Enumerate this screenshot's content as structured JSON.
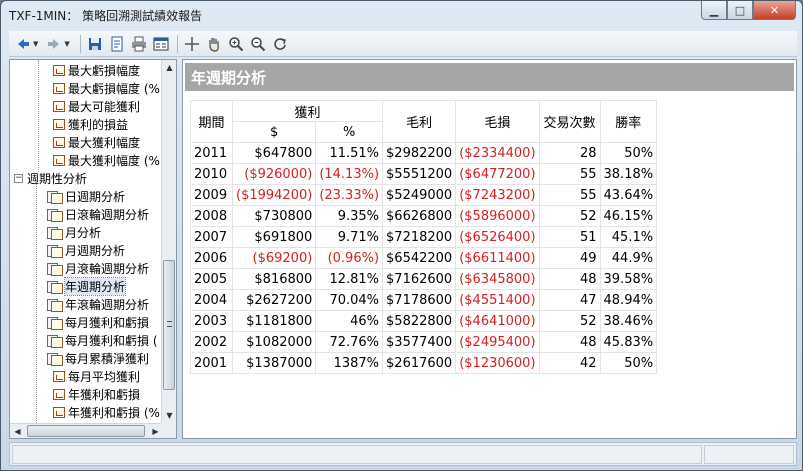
{
  "window": {
    "title": "TXF-1MIN： 策略回溯測試績效報告"
  },
  "toolbar": {
    "buttons": [
      "back-icon",
      "forward-icon",
      "save-icon",
      "page-setup-icon",
      "print-icon",
      "view-icon",
      "crosshair-icon",
      "hand-icon",
      "zoom-in-icon",
      "zoom-out-icon",
      "refresh-icon"
    ]
  },
  "tree": {
    "items": [
      {
        "label": "最大虧損幅度",
        "kind": "report"
      },
      {
        "label": "最大虧損幅度 (%",
        "kind": "report"
      },
      {
        "label": "最大可能獲利",
        "kind": "report"
      },
      {
        "label": "獲利的損益",
        "kind": "report"
      },
      {
        "label": "最大獲利幅度",
        "kind": "report"
      },
      {
        "label": "最大獲利幅度 (%",
        "kind": "report"
      },
      {
        "label": "週期性分析",
        "kind": "folder"
      },
      {
        "label": "日週期分析",
        "kind": "sub"
      },
      {
        "label": "日滾輪週期分析",
        "kind": "sub"
      },
      {
        "label": "月分析",
        "kind": "sub"
      },
      {
        "label": "月週期分析",
        "kind": "sub"
      },
      {
        "label": "月滾輪週期分析",
        "kind": "sub"
      },
      {
        "label": "年週期分析",
        "kind": "sub",
        "selected": true
      },
      {
        "label": "年滾輪週期分析",
        "kind": "sub"
      },
      {
        "label": "每月獲利和虧損",
        "kind": "sub"
      },
      {
        "label": "每月獲利和虧損 (",
        "kind": "sub"
      },
      {
        "label": "每月累積淨獲利",
        "kind": "sub"
      },
      {
        "label": "每月平均獲利",
        "kind": "report"
      },
      {
        "label": "年獲利和虧損",
        "kind": "report"
      },
      {
        "label": "年獲利和虧損 (%",
        "kind": "report"
      }
    ]
  },
  "report": {
    "title": "年週期分析",
    "headers": {
      "period": "期間",
      "profit": "獲利",
      "profit_dollar": "$",
      "profit_pct": "%",
      "gross_profit": "毛利",
      "gross_loss": "毛損",
      "trades": "交易次數",
      "win_rate": "勝率"
    },
    "rows": [
      {
        "year": "2011",
        "profit": "$647800",
        "pct": "11.51%",
        "gross_profit": "$2982200",
        "gross_loss": "($2334400)",
        "trades": "28",
        "win_rate": "50%",
        "negative": false
      },
      {
        "year": "2010",
        "profit": "($926000)",
        "pct": "(14.13%)",
        "gross_profit": "$5551200",
        "gross_loss": "($6477200)",
        "trades": "55",
        "win_rate": "38.18%",
        "negative": true
      },
      {
        "year": "2009",
        "profit": "($1994200)",
        "pct": "(23.33%)",
        "gross_profit": "$5249000",
        "gross_loss": "($7243200)",
        "trades": "55",
        "win_rate": "43.64%",
        "negative": true
      },
      {
        "year": "2008",
        "profit": "$730800",
        "pct": "9.35%",
        "gross_profit": "$6626800",
        "gross_loss": "($5896000)",
        "trades": "52",
        "win_rate": "46.15%",
        "negative": false
      },
      {
        "year": "2007",
        "profit": "$691800",
        "pct": "9.71%",
        "gross_profit": "$7218200",
        "gross_loss": "($6526400)",
        "trades": "51",
        "win_rate": "45.1%",
        "negative": false
      },
      {
        "year": "2006",
        "profit": "($69200)",
        "pct": "(0.96%)",
        "gross_profit": "$6542200",
        "gross_loss": "($6611400)",
        "trades": "49",
        "win_rate": "44.9%",
        "negative": true
      },
      {
        "year": "2005",
        "profit": "$816800",
        "pct": "12.81%",
        "gross_profit": "$7162600",
        "gross_loss": "($6345800)",
        "trades": "48",
        "win_rate": "39.58%",
        "negative": false
      },
      {
        "year": "2004",
        "profit": "$2627200",
        "pct": "70.04%",
        "gross_profit": "$7178600",
        "gross_loss": "($4551400)",
        "trades": "47",
        "win_rate": "48.94%",
        "negative": false
      },
      {
        "year": "2003",
        "profit": "$1181800",
        "pct": "46%",
        "gross_profit": "$5822800",
        "gross_loss": "($4641000)",
        "trades": "52",
        "win_rate": "38.46%",
        "negative": false
      },
      {
        "year": "2002",
        "profit": "$1082000",
        "pct": "72.76%",
        "gross_profit": "$3577400",
        "gross_loss": "($2495400)",
        "trades": "48",
        "win_rate": "45.83%",
        "negative": false
      },
      {
        "year": "2001",
        "profit": "$1387000",
        "pct": "1387%",
        "gross_profit": "$2617600",
        "gross_loss": "($1230600)",
        "trades": "42",
        "win_rate": "50%",
        "negative": false
      }
    ]
  },
  "colors": {
    "negative": "#d42020",
    "header_bar": "#a6a6a6"
  }
}
